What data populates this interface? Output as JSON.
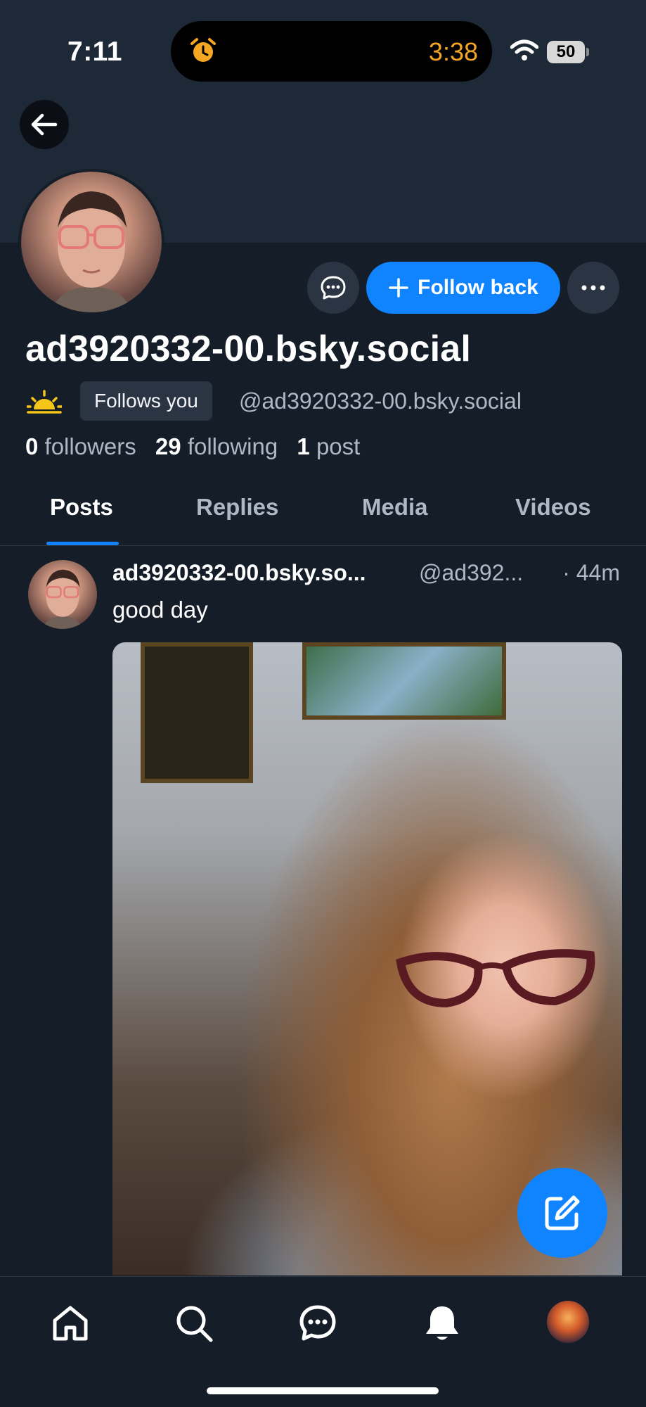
{
  "status_bar": {
    "time": "7:11",
    "timer": "3:38",
    "battery": "50"
  },
  "profile": {
    "display_name": "ad3920332-00.bsky.social",
    "follows_you_badge": "Follows you",
    "handle": "@ad3920332-00.bsky.social",
    "followers_count": "0",
    "followers_label": "followers",
    "following_count": "29",
    "following_label": "following",
    "posts_count": "1",
    "posts_label": "post",
    "follow_button_label": "Follow back"
  },
  "tabs": [
    {
      "label": "Posts",
      "active": true
    },
    {
      "label": "Replies",
      "active": false
    },
    {
      "label": "Media",
      "active": false
    },
    {
      "label": "Videos",
      "active": false
    }
  ],
  "post": {
    "author": "ad3920332-00.bsky.so...",
    "handle": "@ad392...",
    "time": "· 44m",
    "text": "good day"
  },
  "icons": {
    "back": "arrow-left-icon",
    "message": "chat-bubble-icon",
    "more": "ellipsis-icon",
    "follow": "plus-icon",
    "sun": "sunrise-icon",
    "compose": "compose-icon",
    "nav": [
      "home-icon",
      "search-icon",
      "chat-icon",
      "bell-icon",
      "profile-avatar"
    ]
  },
  "colors": {
    "accent": "#1083fe",
    "background": "#151d28",
    "banner": "#1e2938",
    "muted_text": "#aeb8c5",
    "timer": "#f5a623"
  }
}
